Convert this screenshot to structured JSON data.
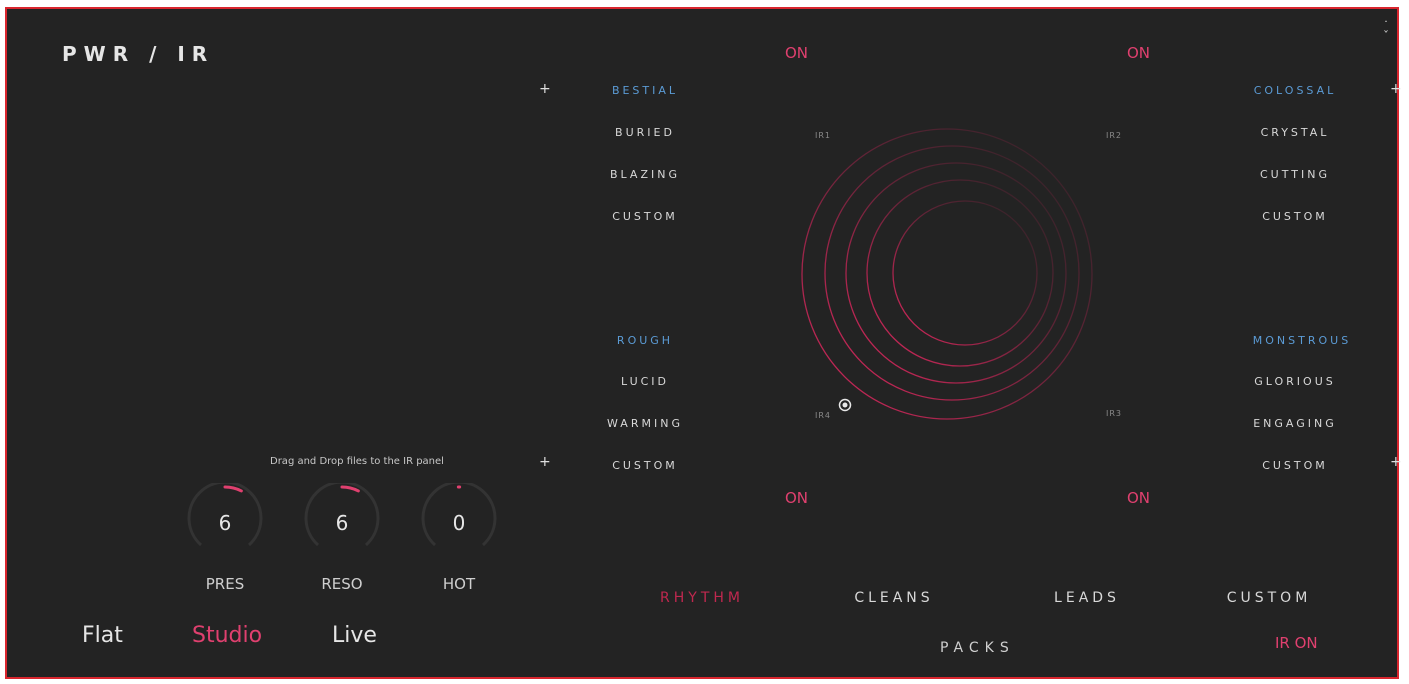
{
  "title": "PWR / IR",
  "close_icon": "collapse-chevrons-icon",
  "on_labels": {
    "top_left": "ON",
    "top_right": "ON",
    "bottom_left": "ON",
    "bottom_right": "ON"
  },
  "banks": {
    "top_left": {
      "category": "BESTIAL",
      "items": [
        "BURIED",
        "BLAZING",
        "CUSTOM"
      ]
    },
    "top_right": {
      "category": "COLOSSAL",
      "items": [
        "CRYSTAL",
        "CUTTING",
        "CUSTOM"
      ]
    },
    "bottom_left": {
      "category": "ROUGH",
      "items": [
        "LUCID",
        "WARMING",
        "CUSTOM"
      ]
    },
    "bottom_right": {
      "category": "MONSTROUS",
      "items": [
        "GLORIOUS",
        "ENGAGING",
        "CUSTOM"
      ]
    }
  },
  "plus_symbol": "+",
  "ir_labels": {
    "ir1": "IR1",
    "ir2": "IR2",
    "ir3": "IR3",
    "ir4": "IR4"
  },
  "drag_text": "Drag and Drop files to the IR panel",
  "knobs": [
    {
      "label": "PRES",
      "value": "6",
      "level": 0.6
    },
    {
      "label": "RESO",
      "value": "6",
      "level": 0.6
    },
    {
      "label": "HOT",
      "value": "0",
      "level": 0.5
    }
  ],
  "modes": {
    "flat": "Flat",
    "studio": "Studio",
    "live": "Live",
    "active": "Studio"
  },
  "pack_tabs": [
    "RHYTHM",
    "CLEANS",
    "LEADS",
    "CUSTOM"
  ],
  "active_pack": "RHYTHM",
  "packs_label": "PACKS",
  "ir_on": "IR ON",
  "colors": {
    "accent": "#e0406f",
    "category": "#5b9bd5",
    "background": "#232323",
    "border": "#d9262e"
  }
}
